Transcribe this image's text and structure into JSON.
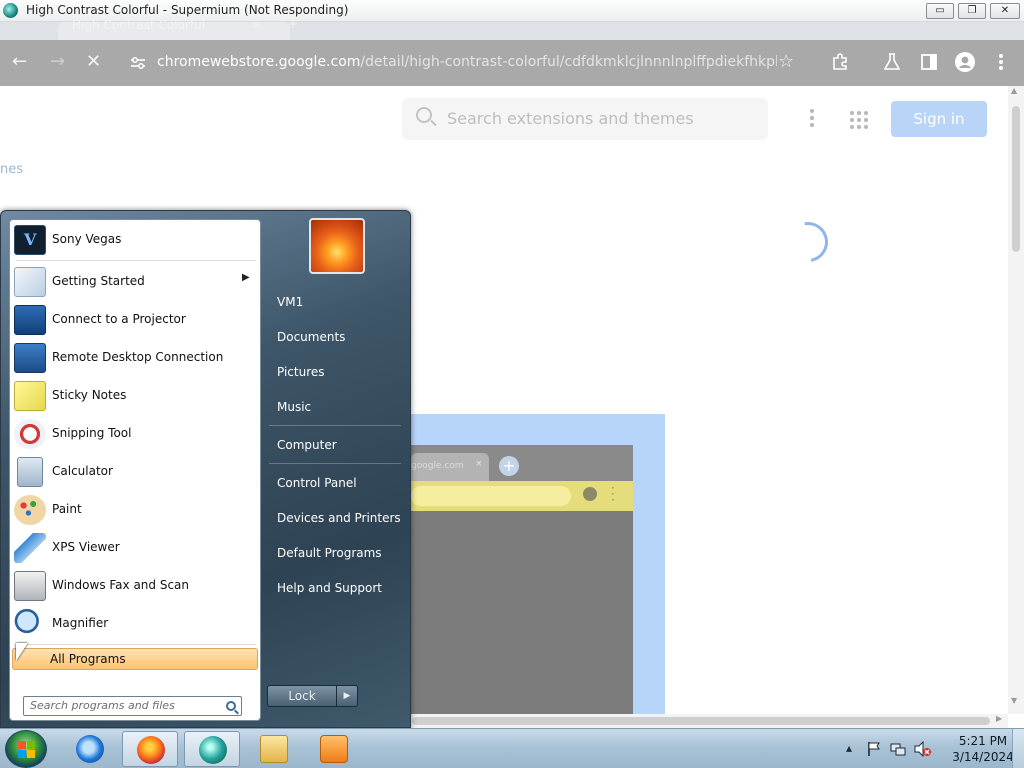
{
  "window": {
    "title": "High Contrast Colorful - Supermium (Not Responding)",
    "minimize_glyph": "▭",
    "restore_glyph": "❐",
    "close_glyph": "✕"
  },
  "tabs": [
    {
      "label": "High Contrast Colorful",
      "close_glyph": "×"
    }
  ],
  "new_tab_glyph": "+",
  "toolbar": {
    "back_glyph": "←",
    "forward_glyph": "→",
    "stop_glyph": "✕",
    "url_host": "chromewebstore.google.com",
    "url_path": "/detail/high-contrast-colorful/cdfdkmklcjlnnnlnplffpdiekfhkpbme?hl...",
    "bookmark_glyph": "☆"
  },
  "page": {
    "search_placeholder": "Search extensions and themes",
    "signin_label": "Sign in",
    "nav_fragment": "nes",
    "preview_tab_text": "google.com",
    "preview_tab_close": "×",
    "preview_plus": "+"
  },
  "start_menu": {
    "pinned": [
      {
        "label": "Sony Vegas",
        "icon": "sony-vegas-icon"
      },
      {
        "label": "Getting Started",
        "icon": "getting-started-icon",
        "has_submenu": true
      },
      {
        "label": "Connect to a Projector",
        "icon": "projector-icon"
      },
      {
        "label": "Remote Desktop Connection",
        "icon": "remote-desktop-icon"
      },
      {
        "label": "Sticky Notes",
        "icon": "sticky-notes-icon"
      },
      {
        "label": "Snipping Tool",
        "icon": "snipping-tool-icon"
      },
      {
        "label": "Calculator",
        "icon": "calculator-icon"
      },
      {
        "label": "Paint",
        "icon": "paint-icon"
      },
      {
        "label": "XPS Viewer",
        "icon": "xps-viewer-icon"
      },
      {
        "label": "Windows Fax and Scan",
        "icon": "fax-scan-icon"
      },
      {
        "label": "Magnifier",
        "icon": "magnifier-icon"
      }
    ],
    "submenu_arrow": "▶",
    "all_programs": "All Programs",
    "search_placeholder": "Search programs and files",
    "right_links": [
      "VM1",
      "Documents",
      "Pictures",
      "Music",
      "Computer",
      "Control Panel",
      "Devices and Printers",
      "Default Programs",
      "Help and Support"
    ],
    "lock_label": "Lock",
    "lock_arrow": "▶"
  },
  "taskbar": {
    "apps": [
      "internet-explorer-icon",
      "firefox-icon",
      "supermium-icon",
      "windows-explorer-icon",
      "media-player-icon"
    ],
    "tray_up_glyph": "▴",
    "time": "5:21 PM",
    "date": "3/14/2024"
  },
  "colors": {
    "start_menu_frame": "#3e5669",
    "all_programs_highlight": "#ffc370",
    "signin_button": "#b8d4f6"
  }
}
